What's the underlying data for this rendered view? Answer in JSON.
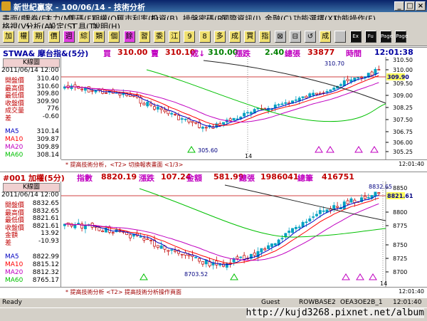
{
  "window": {
    "title": "新世紀贏家 - 100/06/14 - 技術分析"
  },
  "menu1": [
    "畫面(E)",
    "證券(E)",
    "主力(M)",
    "籌碼(F)",
    "期權(O)",
    "匯市利率(F)",
    "投資(B)",
    "操盤密碼(R)",
    "國際資訊(I)",
    "金融(C)",
    "功能選擇(X)",
    "功能操作(F)"
  ],
  "menu2": [
    "格視(V)",
    "分析(A)",
    "設定(S)",
    "工具(T)",
    "說明(H)"
  ],
  "toolbar": [
    "加",
    "權",
    "期",
    "價",
    "週",
    "綜",
    "類",
    "個",
    "餘",
    "習",
    "委",
    "江",
    "9",
    "8",
    "多",
    "成",
    "買",
    "指",
    "⊠",
    "⊟",
    "↺",
    "成",
    "",
    "Ex",
    "Fu",
    "Page",
    "Page"
  ],
  "panel1": {
    "header": {
      "symbol": "STWA& 摩台指&(5分)",
      "buy_label": "買",
      "buy": "310.00",
      "sell_label": "賣",
      "sell": "310.10",
      "deal_label": "成↓",
      "deal": "310.00",
      "change_label": "漲跌",
      "change": "2.40",
      "vol_label": "總張",
      "vol": "33877",
      "time_label": "時間",
      "time": "12:01:38"
    },
    "left": {
      "head": "K線圖",
      "date": "2011/06/14 12:00",
      "rows": [
        {
          "label": "開盤價",
          "value": "310.40"
        },
        {
          "label": "最高價",
          "value": "310.60"
        },
        {
          "label": "最低價",
          "value": "309.80"
        },
        {
          "label": "收盤價",
          "value": "309.90"
        },
        {
          "label": "成交量",
          "value": "776"
        },
        {
          "label": "差",
          "value": "-0.60"
        }
      ],
      "ma": [
        {
          "label": "MA5",
          "value": "310.14"
        },
        {
          "label": "MA10",
          "value": "309.87"
        },
        {
          "label": "MA20",
          "value": "309.89"
        },
        {
          "label": "MA60",
          "value": "308.14"
        }
      ]
    },
    "annotations": {
      "high": "310.70",
      "low": "305.60",
      "last": "309.90",
      "day": "14"
    },
    "footer": "* 提高技術分析，<T2> 切換報表畫面 <1/3>",
    "footer_time": "12:01:40",
    "yticks": [
      "310.50",
      "310.00",
      "309.50",
      "309.00",
      "308.25",
      "307.50",
      "306.75",
      "306.00",
      "305.25"
    ]
  },
  "panel2": {
    "header": {
      "symbol": "#001 加權(5分)",
      "index_label": "指數",
      "index": "8820.19",
      "change_label": "漲跌",
      "change": "107.24",
      "amount_label": "金額",
      "amount": "581.99",
      "vol_label": "總張",
      "vol": "1986041",
      "count_label": "總筆",
      "count": "416751"
    },
    "left": {
      "head": "K線圖",
      "date": "2011/06/14 12:00",
      "rows": [
        {
          "label": "開盤價",
          "value": "8832.65"
        },
        {
          "label": "最高價",
          "value": "8832.65"
        },
        {
          "label": "最低價",
          "value": "8821.61"
        },
        {
          "label": "收盤價",
          "value": "8821.61"
        },
        {
          "label": "金額",
          "value": "13.92"
        },
        {
          "label": "差",
          "value": "-10.93"
        }
      ],
      "ma": [
        {
          "label": "MA5",
          "value": "8822.99"
        },
        {
          "label": "MA10",
          "value": "8815.12"
        },
        {
          "label": "MA20",
          "value": "8812.32"
        },
        {
          "label": "MA60",
          "value": "8765.17"
        }
      ]
    },
    "annotations": {
      "high": "8832.65",
      "low": "8703.52",
      "last": "8821.61",
      "day": "14"
    },
    "footer": "* 提高技術分析 <T2> 提高技術分析操作頁面",
    "footer_time": "12:01:40",
    "yticks": [
      "8850",
      "8800",
      "8775",
      "8750",
      "8725",
      "8700"
    ]
  },
  "status": {
    "ready": "Ready",
    "guest": "Guest",
    "base": "ROWBASE2",
    "server": "OEA3OE2B_1",
    "time": "12:01:40"
  },
  "watermark": "http://kujd3268.pixnet.net/album",
  "colors": {
    "up": "#c00000",
    "down": "#00a0c0",
    "ma5": "#0000c0",
    "ma10": "#ff0000",
    "ma20": "#c000c0",
    "ma60": "#00c000",
    "ma_long": "#202020"
  }
}
